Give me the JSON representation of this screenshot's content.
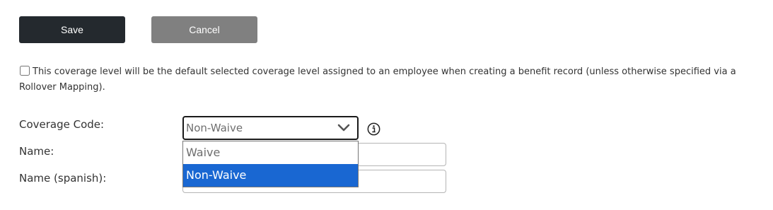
{
  "toolbar": {
    "save_label": "Save",
    "cancel_label": "Cancel"
  },
  "default_option": {
    "checked": false,
    "text": "This coverage level will be the default selected coverage level assigned to an employee when creating a benefit record (unless otherwise specified via a Rollover Mapping)."
  },
  "form": {
    "coverage_code": {
      "label": "Coverage Code:",
      "selected": "Non-Waive",
      "options": [
        "Waive",
        "Non-Waive"
      ],
      "info_icon": "info-circle-icon"
    },
    "name": {
      "label": "Name:",
      "value": ""
    },
    "name_spanish": {
      "label": "Name (spanish):",
      "value": ""
    }
  },
  "colors": {
    "save_bg": "#24292e",
    "cancel_bg": "#808080",
    "option_highlight": "#1967d2"
  }
}
